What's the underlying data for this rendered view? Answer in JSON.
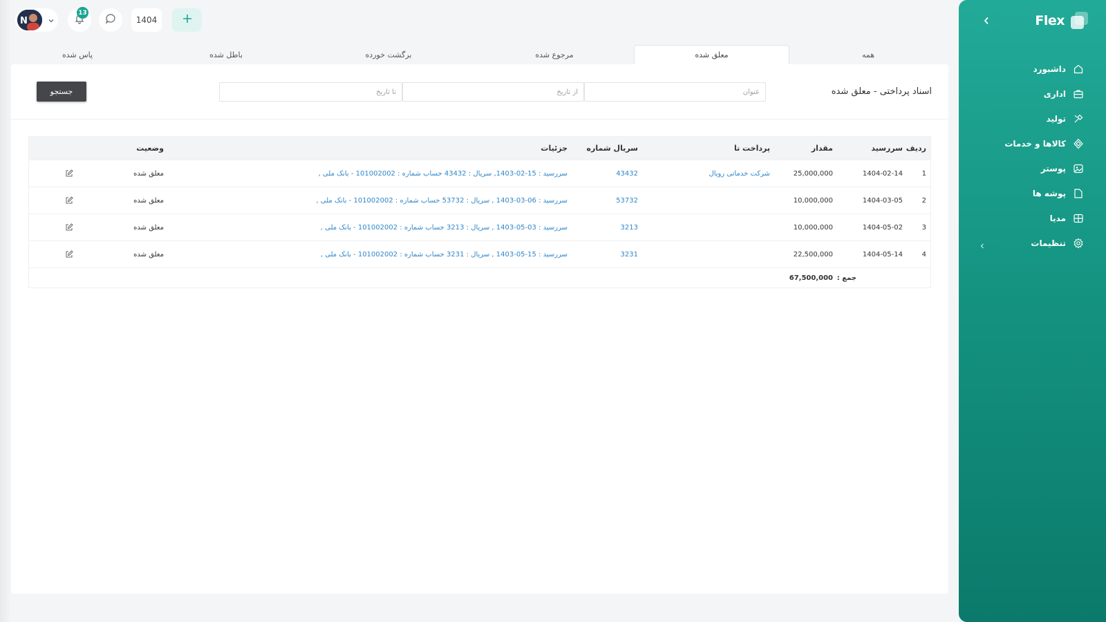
{
  "sidebar": {
    "brand": "Flex",
    "items": [
      {
        "label": "داشبورد",
        "icon": "home-icon"
      },
      {
        "label": "اداری",
        "icon": "briefcase-icon"
      },
      {
        "label": "تولید",
        "icon": "tools-icon"
      },
      {
        "label": "کالاها و خدمات",
        "icon": "cube-icon"
      },
      {
        "label": "پوستر",
        "icon": "image-icon"
      },
      {
        "label": "پوشه ها",
        "icon": "folder-icon"
      },
      {
        "label": "مدیا",
        "icon": "media-icon"
      },
      {
        "label": "تنظیمات",
        "icon": "gear-icon"
      }
    ]
  },
  "topbar": {
    "year": "1404",
    "notifications_count": "13"
  },
  "tabs": [
    {
      "label": "همه",
      "active": false
    },
    {
      "label": "معلق شده",
      "active": true
    },
    {
      "label": "مرجوع شده",
      "active": false
    },
    {
      "label": "برگشت خورده",
      "active": false
    },
    {
      "label": "باطل شده",
      "active": false
    },
    {
      "label": "پاس شده",
      "active": false
    }
  ],
  "page": {
    "title": "اسناد پرداختی - معلق شده",
    "filters": {
      "title_placeholder": "عنوان",
      "from_placeholder": "از تاریخ",
      "to_placeholder": "تا تاریخ"
    },
    "search_label": "جستجو"
  },
  "table": {
    "headers": {
      "idx": "ردیف",
      "due": "سررسید",
      "amount": "مقدار",
      "pay_to": "پرداخت تا",
      "serial": "سریال شماره",
      "details": "جزئیات",
      "status": "وضعیت"
    },
    "rows": [
      {
        "idx": "1",
        "due": "1404-02-14",
        "amount": "25,000,000",
        "pay_to": "شرکت خدماتی رویال",
        "serial": "43432",
        "details": "سررسید : 15-02-1403, سریال : 43432 حساب شماره : 101002002 - بانک ملی ,",
        "status": "معلق شده"
      },
      {
        "idx": "2",
        "due": "1404-03-05",
        "amount": "10,000,000",
        "pay_to": "",
        "serial": "53732",
        "details": "سررسید : 06-03-1403 , سریال : 53732 حساب شماره : 101002002 - بانک ملی ,",
        "status": "معلق شده"
      },
      {
        "idx": "3",
        "due": "1404-05-02",
        "amount": "10,000,000",
        "pay_to": "",
        "serial": "3213",
        "details": "سررسید : 03-05-1403 , سریال : 3213 حساب شماره : 101002002 - بانک ملی ,",
        "status": "معلق شده"
      },
      {
        "idx": "4",
        "due": "1404-05-14",
        "amount": "22,500,000",
        "pay_to": "",
        "serial": "3231",
        "details": "سررسید : 15-05-1403 , سریال : 3231 حساب شماره : 101002002 - بانک ملی ,",
        "status": "معلق شده"
      }
    ],
    "sum_label": "جمع :",
    "sum_value": "67,500,000"
  },
  "colors": {
    "accent": "#1aa592",
    "link": "#2f86c8",
    "search_button": "#444649"
  }
}
